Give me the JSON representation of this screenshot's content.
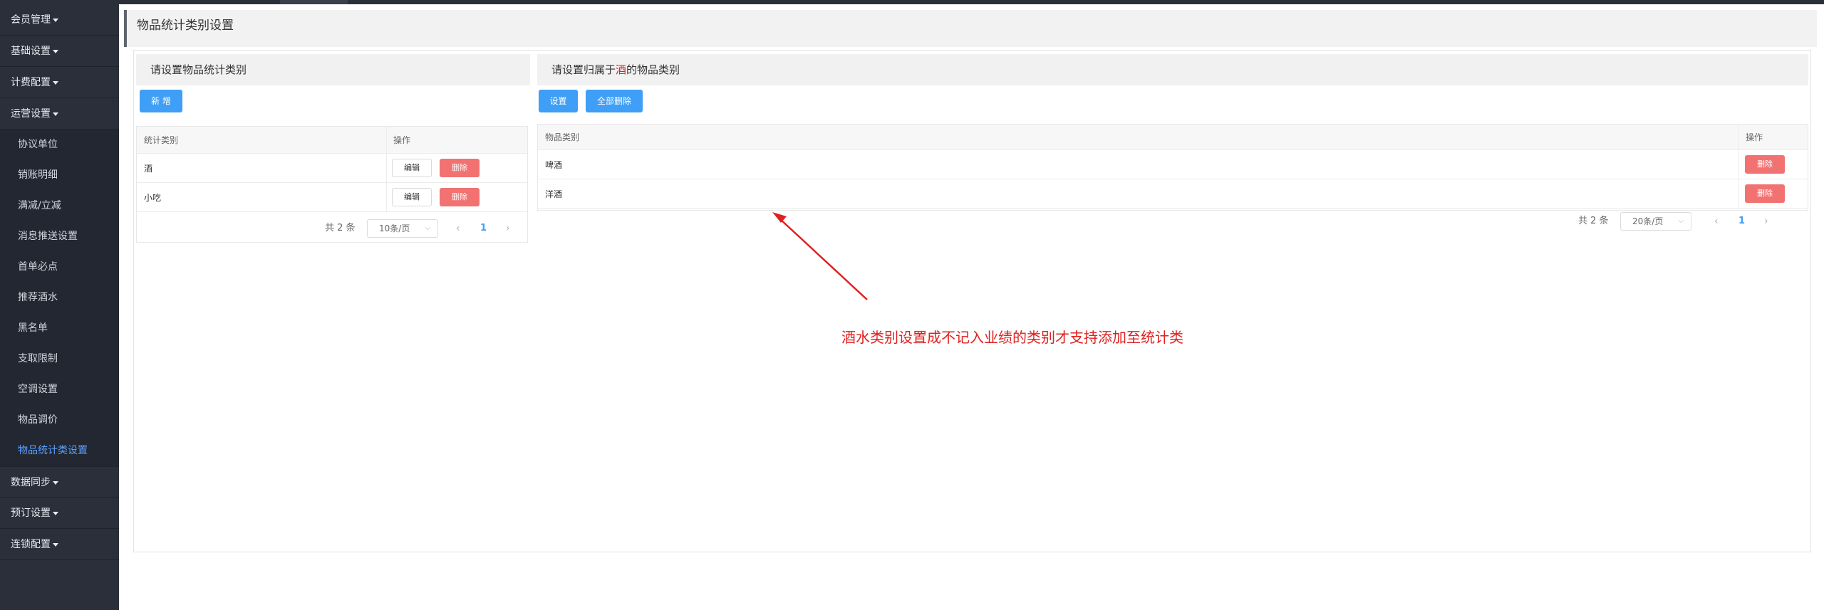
{
  "sidebar": {
    "groups_top": [
      {
        "label": "会员管理"
      },
      {
        "label": "基础设置"
      },
      {
        "label": "计费配置"
      },
      {
        "label": "运营设置"
      }
    ],
    "sub_items": [
      {
        "label": "协议单位"
      },
      {
        "label": "销账明细"
      },
      {
        "label": "满减/立减"
      },
      {
        "label": "消息推送设置"
      },
      {
        "label": "首单必点"
      },
      {
        "label": "推荐酒水"
      },
      {
        "label": "黑名单"
      },
      {
        "label": "支取限制"
      },
      {
        "label": "空调设置"
      },
      {
        "label": "物品调价"
      },
      {
        "label": "物品统计类设置",
        "active": true
      }
    ],
    "groups_bottom": [
      {
        "label": "数据同步"
      },
      {
        "label": "预订设置"
      },
      {
        "label": "连锁配置"
      }
    ]
  },
  "page": {
    "title": "物品统计类别设置"
  },
  "left": {
    "heading": "请设置物品统计类别",
    "add_label": "新 增",
    "columns": [
      "统计类别",
      "操作"
    ],
    "rows": [
      {
        "name": "酒",
        "edit": "编辑",
        "delete": "删除"
      },
      {
        "name": "小吃",
        "edit": "编辑",
        "delete": "删除"
      }
    ],
    "pager": {
      "total": "共 2 条",
      "size": "10条/页",
      "page": "1"
    }
  },
  "right": {
    "heading_prefix": "请设置归属于",
    "heading_highlight": "酒",
    "heading_suffix": "的物品类别",
    "set_label": "设置",
    "delete_all_label": "全部删除",
    "columns": [
      "物品类别",
      "操作"
    ],
    "rows": [
      {
        "name": "啤酒",
        "delete": "删除"
      },
      {
        "name": "洋酒",
        "delete": "删除"
      }
    ],
    "pager": {
      "total": "共 2 条",
      "size": "20条/页",
      "page": "1"
    }
  },
  "annotation": {
    "text": "酒水类别设置成不记入业绩的类别才支持添加至统计类"
  },
  "colors": {
    "sidebar_bg": "#2b2f3a",
    "primary": "#3f9ef6",
    "danger": "#f27272",
    "active_menu": "#5aa0ff",
    "annotation": "#e02020"
  }
}
